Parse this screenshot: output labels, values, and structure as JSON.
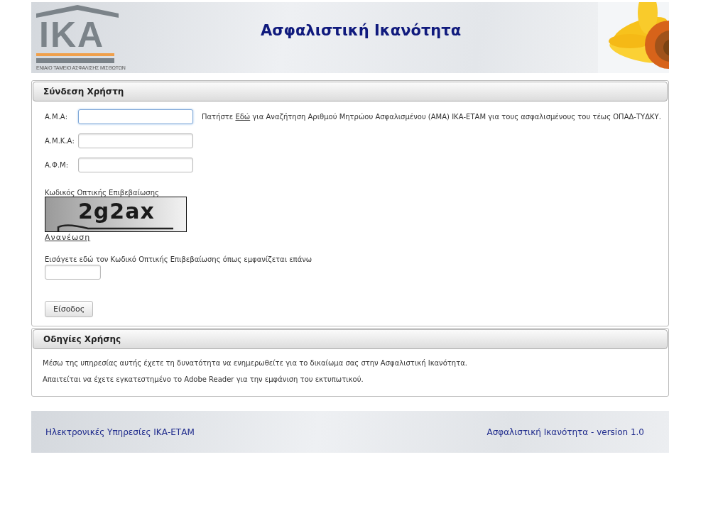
{
  "header": {
    "logo": "IKA",
    "logo_tagline": "ΕΝΙΑΙΟ ΤΑΜΕΙΟ ΑΣΦΑΛΙΣΗΣ ΜΙΣΘΩΤΩΝ",
    "title": "Ασφαλιστική Ικανότητα"
  },
  "login": {
    "title": "Σύνδεση Χρήστη",
    "fields": [
      {
        "label": "Α.Μ.Α:",
        "focused": true
      },
      {
        "label": "Α.Μ.Κ.Α:",
        "focused": false
      },
      {
        "label": "Α.Φ.Μ:",
        "focused": false
      }
    ],
    "hint": {
      "before": "Πατήστε",
      "link": "Εδώ",
      "after": "για Αναζήτηση Αριθμού Μητρώου Ασφαλισμένου (ΑΜΑ) ΙΚΑ-ΕΤΑΜ για τους ασφαλισμένους του τέως ΟΠΑΔ-ΤΥΔΚΥ."
    },
    "captcha_label": "Κωδικός Οπτικής Επιβεβαίωσης",
    "captcha_code": "2g2ax",
    "refresh_link": "Ανανέωση",
    "captcha_prompt": "Εισάγετε εδώ τον Κωδικό Οπτικής Επιβεβαίωσης όπως εμφανίζεται επάνω",
    "submit": "Είσοδος"
  },
  "instructions": {
    "title": "Οδηγίες Χρήσης",
    "paragraphs": [
      "Μέσω της υπηρεσίας αυτής έχετε τη δυνατότητα να ενημερωθείτε για το δικαίωμα σας στην Ασφαλιστική Ικανότητα.",
      "Απαιτείται να έχετε εγκατεστημένο το Adobe Reader για την εμφάνιση του εκτυπωτικού."
    ]
  },
  "footer": {
    "left": "Ηλεκτρονικές Υπηρεσίες ΙΚΑ-ΕΤΑΜ",
    "right": "Ασφαλιστική Ικανότητα - version 1.0"
  }
}
